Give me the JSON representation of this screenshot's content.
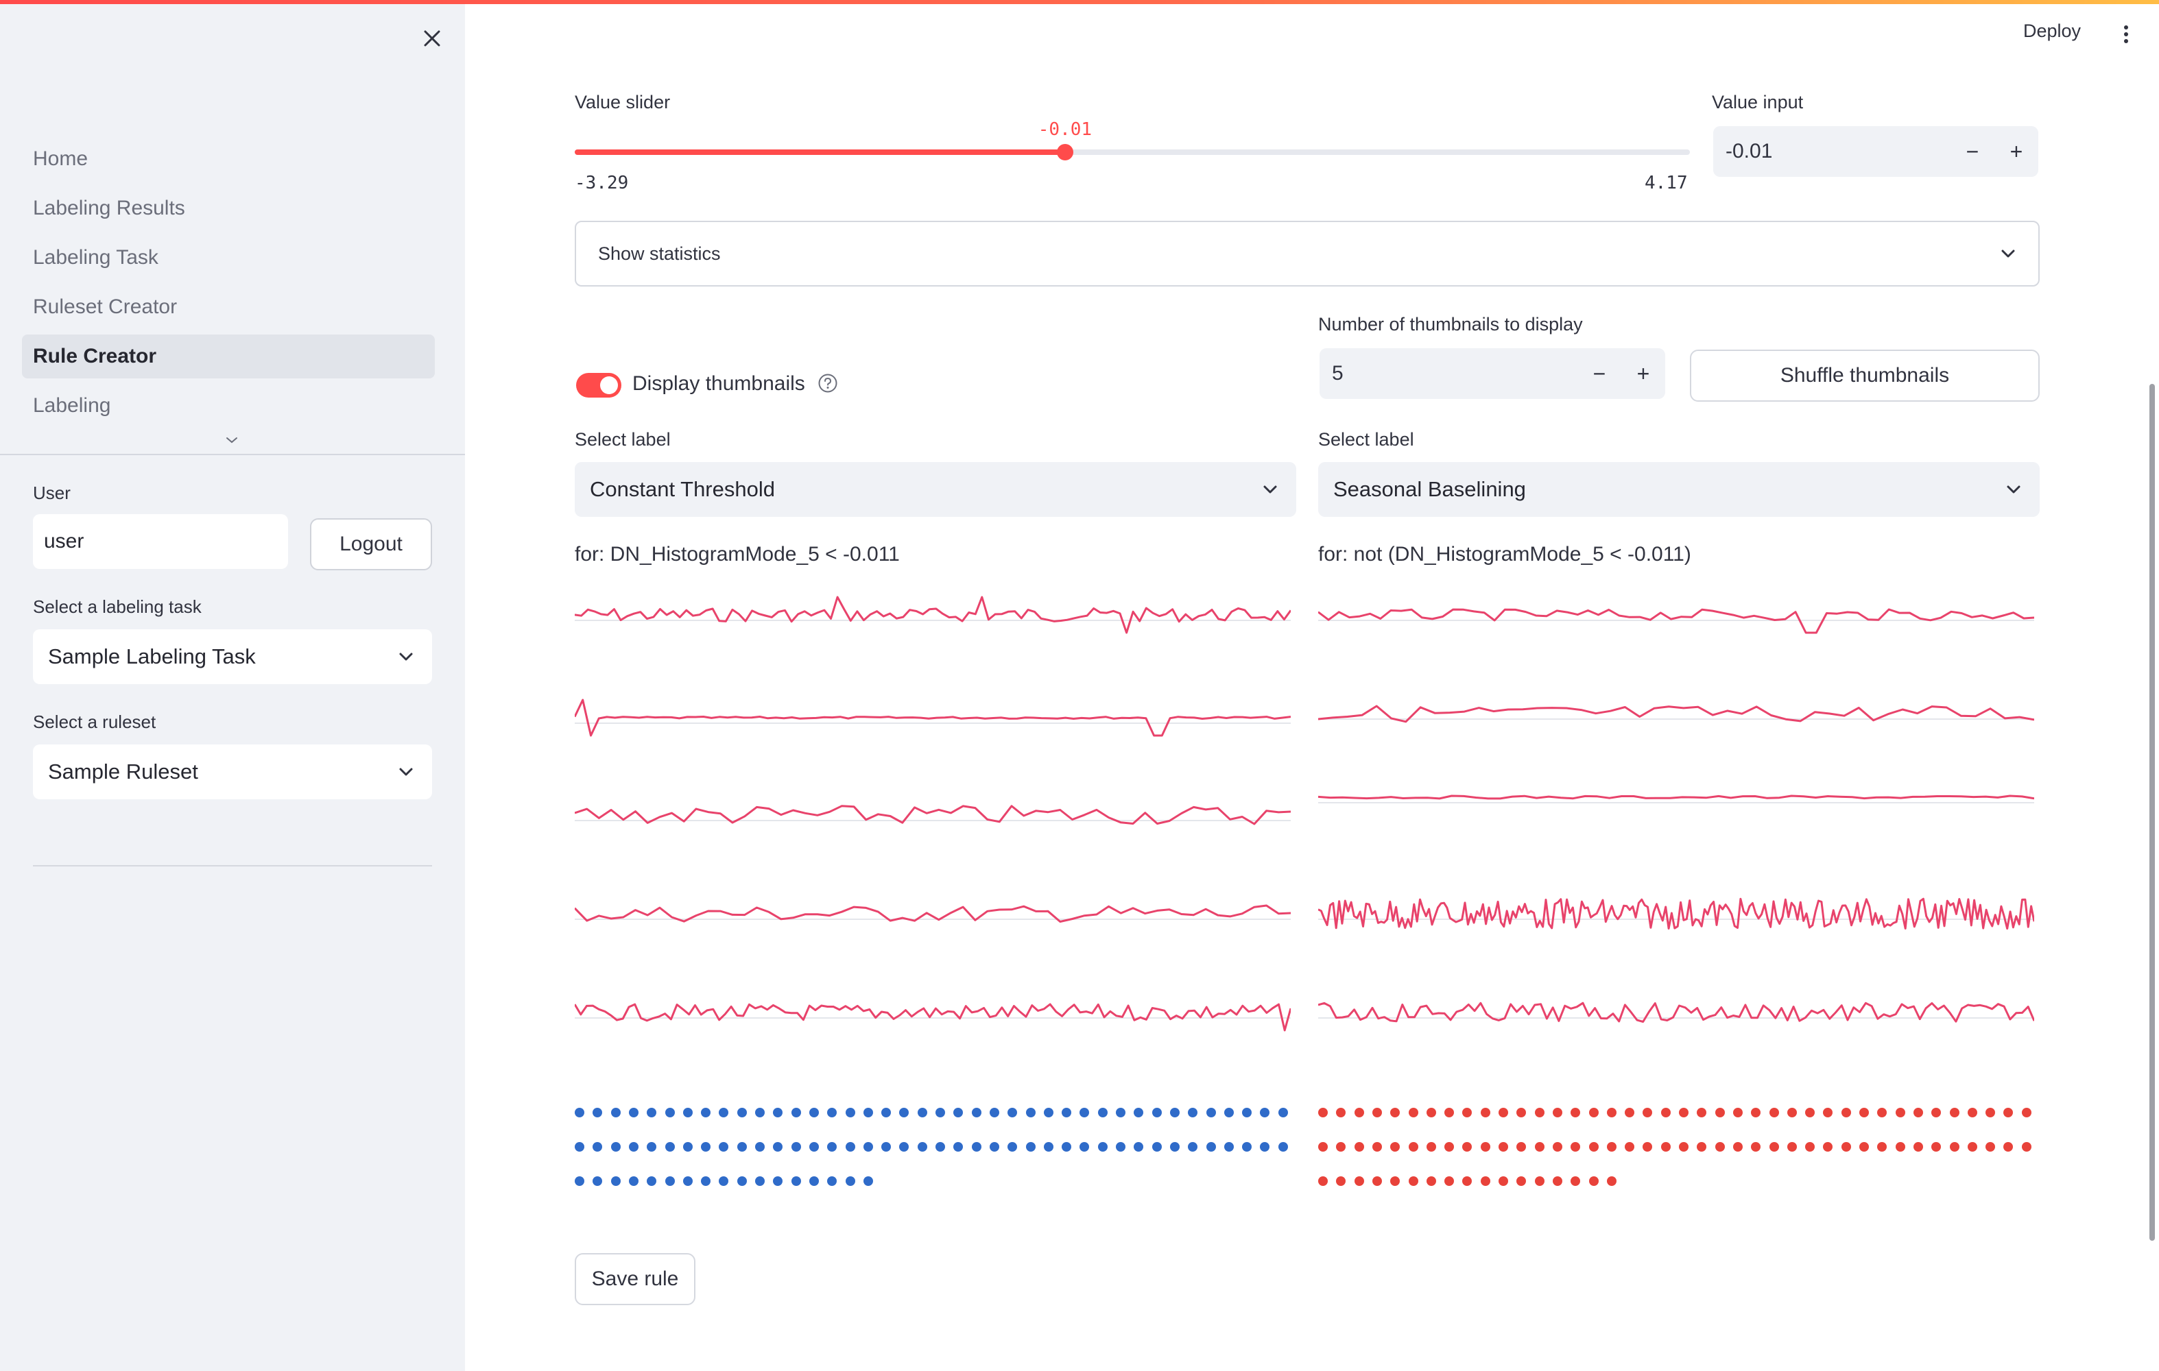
{
  "sidebar": {
    "nav_items": [
      {
        "label": "Home"
      },
      {
        "label": "Labeling Results"
      },
      {
        "label": "Labeling Task"
      },
      {
        "label": "Ruleset Creator"
      },
      {
        "label": "Rule Creator"
      },
      {
        "label": "Labeling"
      }
    ],
    "active_nav": "Rule Creator",
    "user_label": "User",
    "user_value": "user",
    "logout_label": "Logout",
    "task_label": "Select a labeling task",
    "task_value": "Sample Labeling Task",
    "ruleset_label": "Select a ruleset",
    "ruleset_value": "Sample Ruleset"
  },
  "header": {
    "deploy_label": "Deploy"
  },
  "main": {
    "slider": {
      "label": "Value slider",
      "value": -0.01,
      "value_text": "-0.01",
      "min": -3.29,
      "min_text": "-3.29",
      "max": 4.17,
      "max_text": "4.17"
    },
    "value_input": {
      "label": "Value input",
      "value": "-0.01",
      "minus": "−",
      "plus": "+"
    },
    "statistics_label": "Show statistics",
    "display_thumbnails": {
      "label": "Display thumbnails",
      "checked": true
    },
    "num_thumbnails": {
      "label": "Number of thumbnails to display",
      "value": "5",
      "minus": "−",
      "plus": "+"
    },
    "shuffle_label": "Shuffle thumbnails",
    "left": {
      "select_label": "Select label",
      "select_value": "Constant Threshold",
      "for_text": "for: DN_HistogramMode_5 < -0.011",
      "dot_count": 97,
      "dot_color": "#2f6bc9"
    },
    "right": {
      "select_label": "Select label",
      "select_value": "Seasonal Baselining",
      "for_text": "for: not (DN_HistogramMode_5 < -0.011)",
      "dot_count": 97,
      "dot_color": "#e8423a"
    },
    "thumbnail_color": "#e8436b",
    "save_label": "Save rule"
  },
  "colors": {
    "accent": "#ff4b4b",
    "sidebar_bg": "#f0f2f6"
  }
}
